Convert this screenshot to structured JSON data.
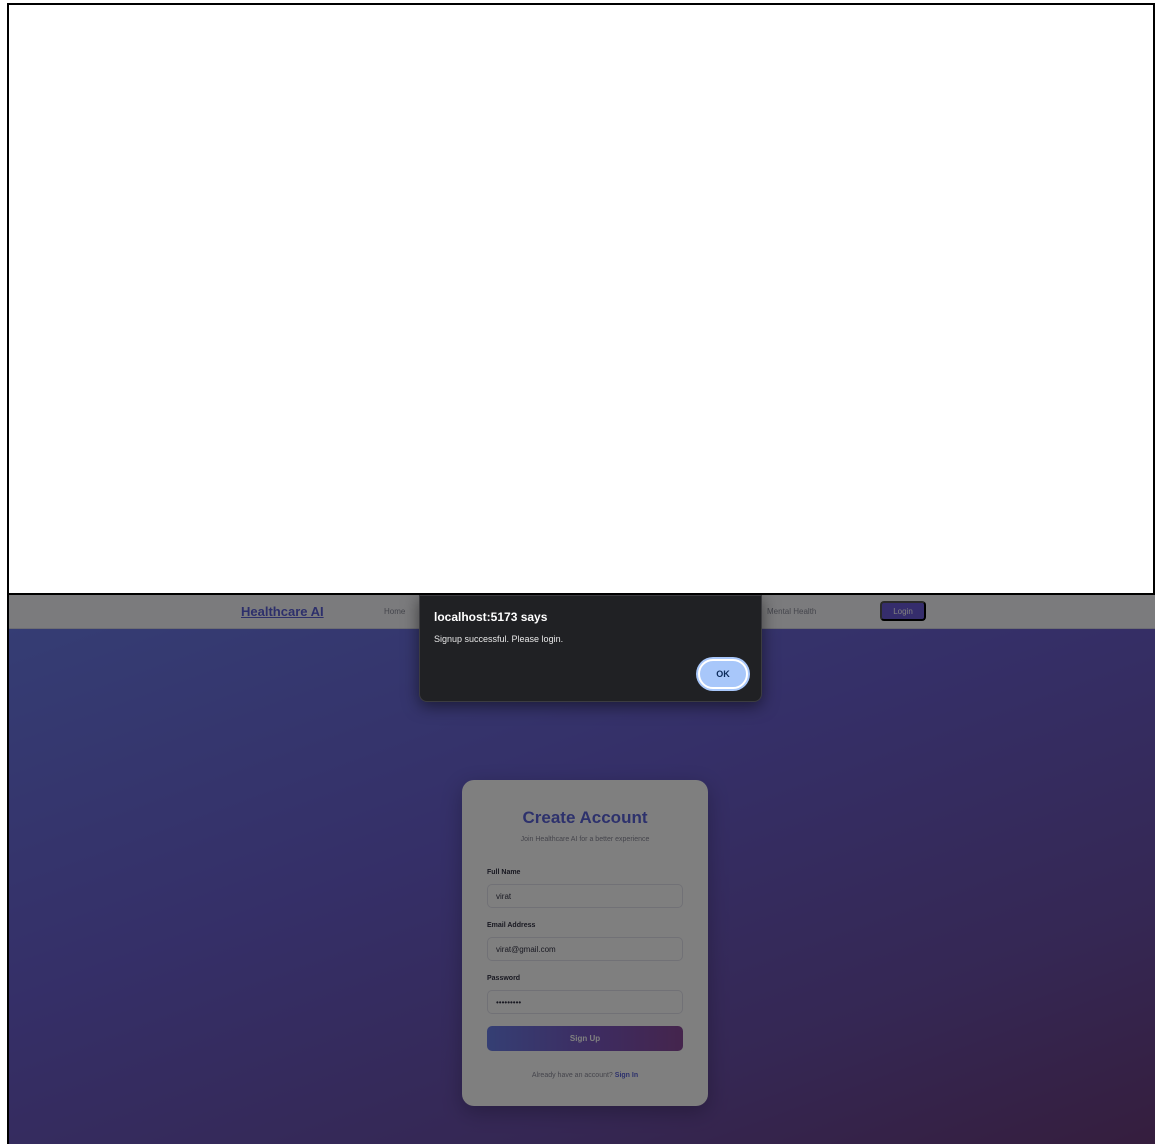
{
  "navbar": {
    "brand": "Healthcare AI",
    "links": [
      "Home",
      "Mental Health"
    ],
    "login_label": "Login"
  },
  "signup_card": {
    "title": "Create Account",
    "subtitle": "Join Healthcare AI for a better experience",
    "full_name_label": "Full Name",
    "full_name_value": "virat",
    "email_label": "Email Address",
    "email_value": "virat@gmail.com",
    "password_label": "Password",
    "password_value": "•••••••••",
    "submit_label": "Sign Up",
    "signin_prompt": "Already have an account?",
    "signin_link": "Sign In"
  },
  "alert_dialog": {
    "title": "localhost:5173 says",
    "message": "Signup successful. Please login.",
    "ok_label": "OK"
  }
}
